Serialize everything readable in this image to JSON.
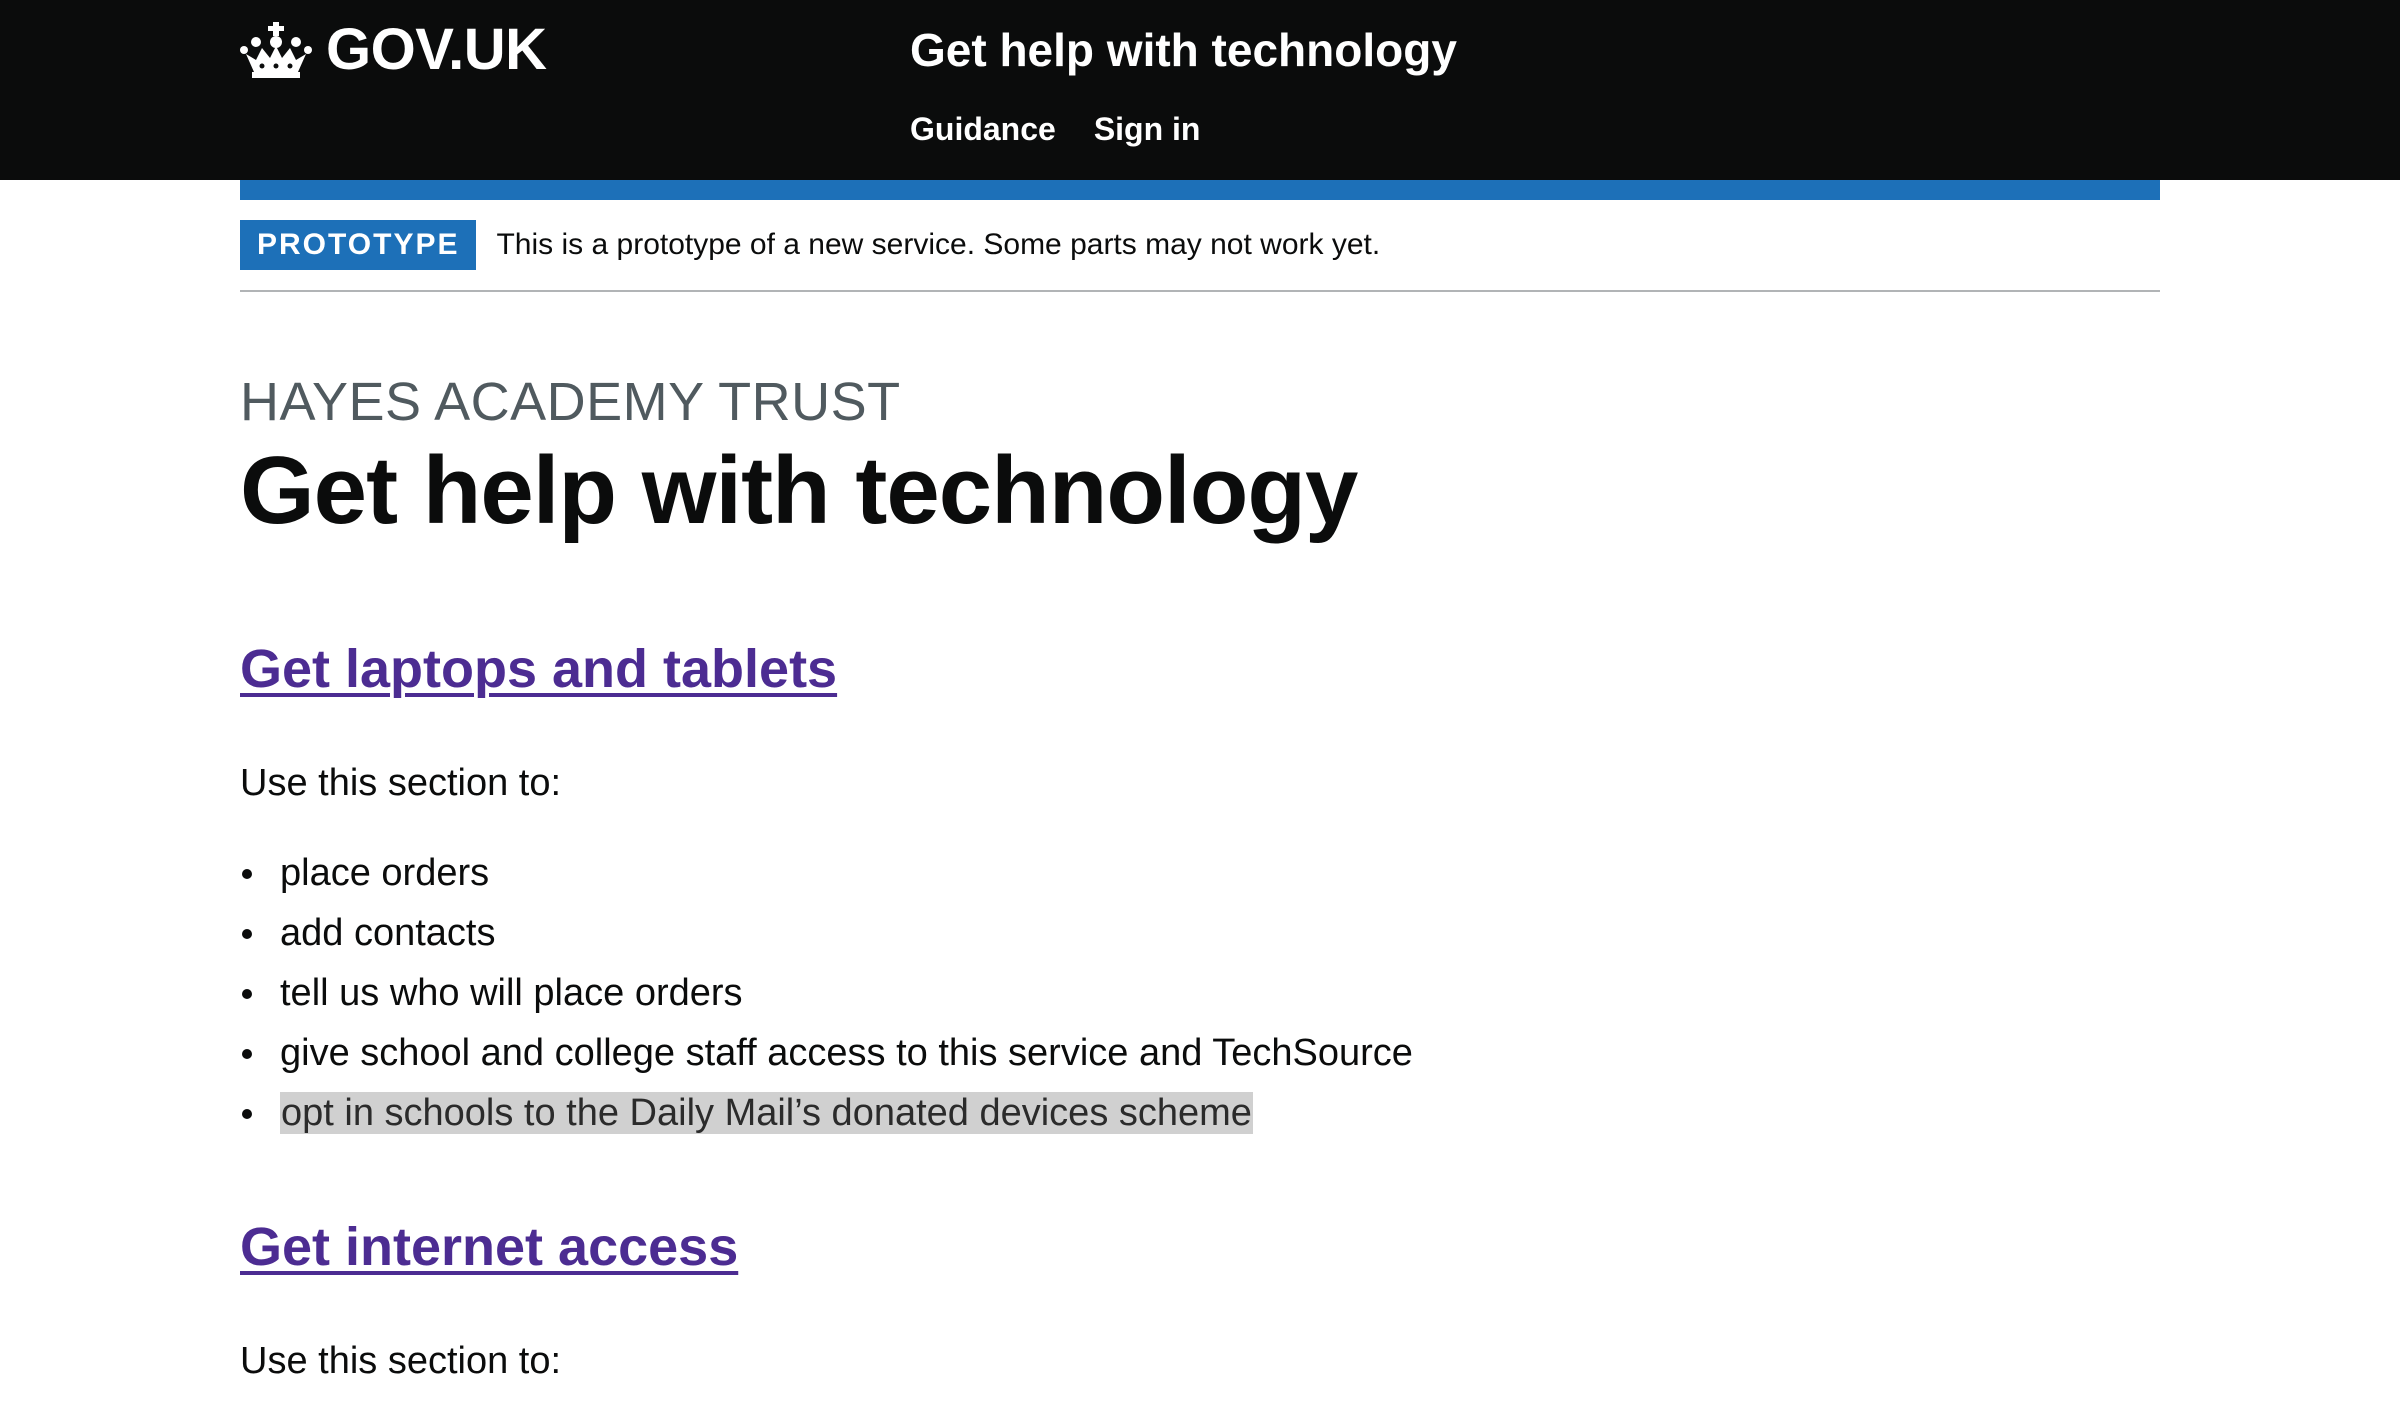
{
  "header": {
    "logo_text": "GOV.UK",
    "service_name": "Get help with technology",
    "nav": [
      {
        "label": "Guidance"
      },
      {
        "label": "Sign in"
      }
    ]
  },
  "phase_banner": {
    "tag": "PROTOTYPE",
    "text": "This is a prototype of a new service. Some parts may not work yet."
  },
  "main": {
    "caption": "HAYES ACADEMY TRUST",
    "title": "Get help with technology",
    "sections": [
      {
        "link": "Get laptops and tablets",
        "intro": "Use this section to:",
        "items": [
          "place orders",
          "add contacts",
          "tell us who will place orders",
          "give school and college staff access to this service and TechSource",
          "opt in schools to the Daily Mail’s donated devices scheme"
        ]
      },
      {
        "link": "Get internet access",
        "intro": "Use this section to:"
      }
    ]
  },
  "colors": {
    "header_bg": "#0b0c0c",
    "brand_blue": "#1d70b8",
    "link_visited": "#4c2c92",
    "caption_grey": "#505a5f",
    "highlight": "#d0d0d0"
  }
}
